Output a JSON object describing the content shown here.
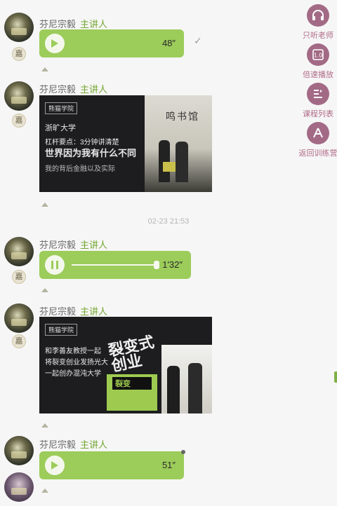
{
  "speaker": {
    "name": "芬尼宗毅",
    "role": "主讲人"
  },
  "badge_glyph": "嘉",
  "messages": [
    {
      "type": "voice",
      "duration": "48″",
      "status": "✓"
    },
    {
      "type": "image",
      "card": {
        "logo": "熊猫学院",
        "lines": [
          "浙旷大学",
          "杠杆要点：3分钟讲清楚",
          "世界因为我有什么不同",
          "我的背后金融以及实际"
        ],
        "calligraphy": "鸣书馆"
      }
    },
    {
      "type": "timestamp",
      "text": "02-23 21:53"
    },
    {
      "type": "voice_playing",
      "duration": "1′32″"
    },
    {
      "type": "image",
      "card": {
        "logo": "熊猫学院",
        "lines": [
          "和李善友教授一起",
          "将裂变创业发扬光大",
          "一起创办混沌大学"
        ],
        "big_word": "裂变式创业",
        "book_label": "裂变"
      }
    },
    {
      "type": "voice",
      "duration": "51″"
    }
  ],
  "sidebar": [
    {
      "id": "listen",
      "label": "只听老师",
      "icon": "headphones-icon"
    },
    {
      "id": "speed",
      "label": "倍速播放",
      "icon": "speed-icon",
      "glyph": "1.0"
    },
    {
      "id": "list",
      "label": "课程列表",
      "icon": "list-icon"
    },
    {
      "id": "back",
      "label": "返回训练营",
      "icon": "back-icon"
    }
  ],
  "colors": {
    "bubble": "#9ccc5a",
    "role": "#73a62f",
    "sidebar": "#a36a86"
  }
}
